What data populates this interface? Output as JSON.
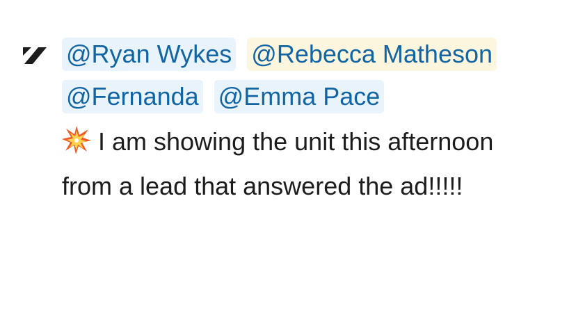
{
  "message": {
    "mentions_row1": [
      {
        "label": "@Ryan Wykes",
        "kind": "regular"
      },
      {
        "label": "@Rebecca Matheson",
        "kind": "self"
      }
    ],
    "mentions_row2": [
      {
        "label": "@Fernanda",
        "kind": "regular"
      },
      {
        "label": "@Emma Pace",
        "kind": "regular"
      }
    ],
    "emoji": "collision-icon",
    "text": "I am showing the unit this afternoon from a lead that answered the ad!!!!!"
  },
  "colors": {
    "mention_bg": "#e8f3fb",
    "self_mention_bg": "#fdf6df",
    "mention_text": "#1264a3",
    "body_text": "#1d1c1d"
  },
  "icons": {
    "app_logo": "app-logo-icon"
  }
}
